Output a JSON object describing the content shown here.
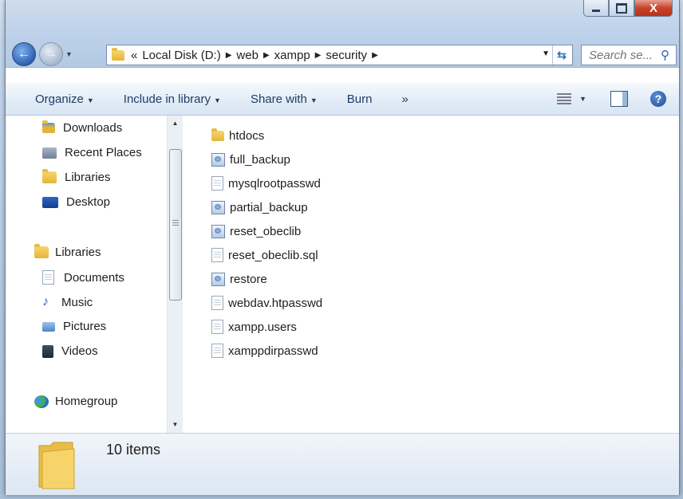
{
  "window": {
    "close_glyph": "X"
  },
  "nav": {
    "back_glyph": "←",
    "forward_glyph": "→"
  },
  "address": {
    "prefix": "«",
    "crumbs": [
      "Local Disk (D:)",
      "web",
      "xampp",
      "security"
    ],
    "separator": "▶"
  },
  "search": {
    "placeholder": "Search se..."
  },
  "toolbar": {
    "organize": "Organize",
    "include": "Include in library",
    "share": "Share with",
    "burn": "Burn",
    "more": "»",
    "help_glyph": "?"
  },
  "sidebar": {
    "items": [
      {
        "label": "Downloads",
        "icon": "downloads-icon"
      },
      {
        "label": "Recent Places",
        "icon": "recent-places-icon"
      },
      {
        "label": "Libraries",
        "icon": "libraries-icon"
      },
      {
        "label": "Desktop",
        "icon": "desktop-icon"
      },
      {
        "label": "Libraries",
        "icon": "libraries-icon"
      },
      {
        "label": "Documents",
        "icon": "documents-icon"
      },
      {
        "label": "Music",
        "icon": "music-icon"
      },
      {
        "label": "Pictures",
        "icon": "pictures-icon"
      },
      {
        "label": "Videos",
        "icon": "videos-icon"
      },
      {
        "label": "Homegroup",
        "icon": "homegroup-icon"
      }
    ]
  },
  "files": [
    {
      "name": "htdocs",
      "type": "folder"
    },
    {
      "name": "full_backup",
      "type": "batch"
    },
    {
      "name": "mysqlrootpasswd",
      "type": "document"
    },
    {
      "name": "partial_backup",
      "type": "batch"
    },
    {
      "name": "reset_obeclib",
      "type": "batch"
    },
    {
      "name": "reset_obeclib.sql",
      "type": "document"
    },
    {
      "name": "restore",
      "type": "batch"
    },
    {
      "name": "webdav.htpasswd",
      "type": "document"
    },
    {
      "name": "xampp.users",
      "type": "document"
    },
    {
      "name": "xamppdirpasswd",
      "type": "document"
    }
  ],
  "status": {
    "count": "10 items"
  },
  "colors": {
    "toolbar_text": "#1f3d66",
    "accent": "#2c62b4"
  }
}
